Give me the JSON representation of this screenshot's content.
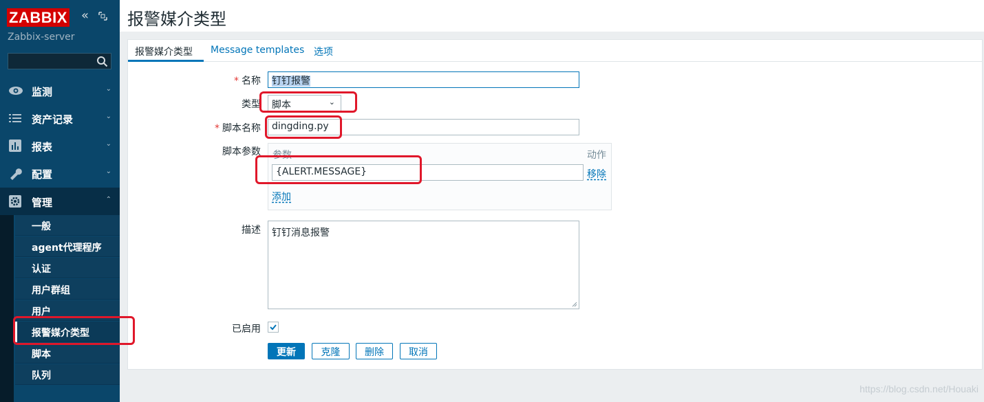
{
  "brand": {
    "logo": "ZABBIX",
    "server": "Zabbix-server"
  },
  "sidebar": {
    "menu": [
      {
        "label": "监测",
        "icon": "eye-icon"
      },
      {
        "label": "资产记录",
        "icon": "list-icon"
      },
      {
        "label": "报表",
        "icon": "bar-chart-icon"
      },
      {
        "label": "配置",
        "icon": "wrench-icon"
      },
      {
        "label": "管理",
        "icon": "gear-icon"
      }
    ],
    "submenu": [
      "一般",
      "agent代理程序",
      "认证",
      "用户群组",
      "用户",
      "报警媒介类型",
      "脚本",
      "队列"
    ]
  },
  "page": {
    "title": "报警媒介类型"
  },
  "tabs": [
    "报警媒介类型",
    "Message templates",
    "选项"
  ],
  "form": {
    "name_label": "名称",
    "name_value": "钉钉报警",
    "type_label": "类型",
    "type_value": "脚本",
    "script_name_label": "脚本名称",
    "script_name_value": "dingding.py",
    "params_label": "脚本参数",
    "params_col_param": "参数",
    "params_col_action": "动作",
    "param_value": "{ALERT.MESSAGE}",
    "remove_label": "移除",
    "add_label": "添加",
    "description_label": "描述",
    "description_value": "钉钉消息报警",
    "enabled_label": "已启用",
    "required_mark": "*"
  },
  "buttons": {
    "update": "更新",
    "clone": "克隆",
    "delete": "删除",
    "cancel": "取消"
  },
  "watermark": "https://blog.csdn.net/Houaki",
  "colors": {
    "sidebar": "#0a466a",
    "accent": "#0275b8",
    "logo": "#d40000",
    "highlight": "#e0172a"
  }
}
